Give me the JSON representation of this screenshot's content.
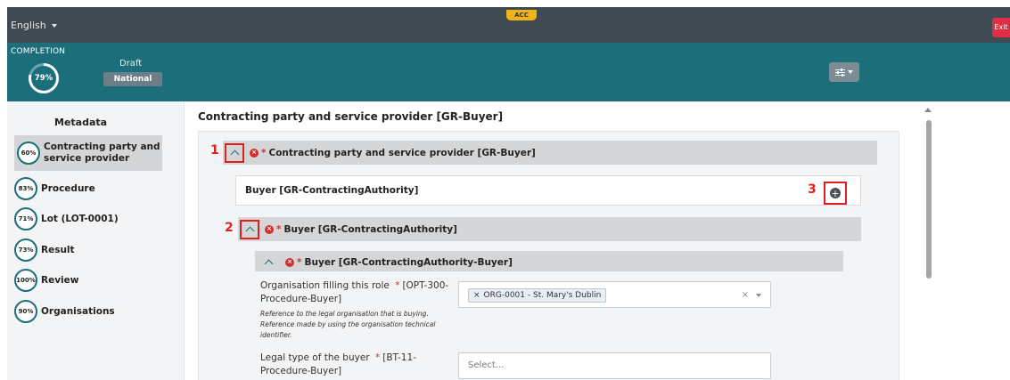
{
  "topbar": {
    "language": "English",
    "env_badge": "ACC",
    "exit_label": "Exit"
  },
  "completion": {
    "label": "COMPLETION",
    "percent": "79%",
    "percent_value": 79,
    "status": "Draft",
    "scope": "National"
  },
  "sidebar": {
    "title": "Metadata",
    "items": [
      {
        "percent": "60%",
        "label_line1": "Contracting party and",
        "label_line2": "service provider",
        "active": true
      },
      {
        "percent": "83%",
        "label": "Procedure"
      },
      {
        "percent": "71%",
        "label": "Lot (LOT-0001)"
      },
      {
        "percent": "73%",
        "label": "Result"
      },
      {
        "percent": "100%",
        "label": "Review"
      },
      {
        "percent": "90%",
        "label": "Organisations"
      }
    ]
  },
  "main": {
    "title": "Contracting party and service provider [GR-Buyer]",
    "group_header": "Contracting party and service provider  [GR-Buyer]",
    "buyer_row": "Buyer  [GR-ContractingAuthority]",
    "buyer_section_header": "Buyer  [GR-ContractingAuthority]",
    "buyer_subsection_header": "Buyer  [GR-ContractingAuthority-Buyer]",
    "annotations": [
      "1",
      "2",
      "3"
    ],
    "fields": {
      "org_role": {
        "label_line1": "Organisation filling this role",
        "label_id_line1": "[OPT-300-",
        "label_line2": "Procedure-Buyer]",
        "help_line1": "Reference to the legal organisation that is buying.",
        "help_line2": "Reference made by using the organisation technical",
        "help_line3": "identifier.",
        "value": "ORG-0001 - St. Mary's Dublin"
      },
      "legal_type": {
        "label_line1": "Legal type of the buyer",
        "label_id_line1": "[BT-11-",
        "label_line2": "Procedure-Buyer]",
        "placeholder": "Select..."
      }
    }
  },
  "colors": {
    "topbar": "#3f4a52",
    "band": "#1b6e7a",
    "accent_red": "#e02020",
    "badge_yellow": "#f0b419"
  }
}
